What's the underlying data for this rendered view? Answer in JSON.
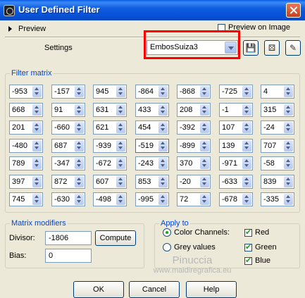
{
  "window": {
    "title": "User Defined Filter"
  },
  "preview": {
    "label": "Preview",
    "preview_on_image": "Preview on Image"
  },
  "settings": {
    "label": "Settings",
    "preset_value": "EmbosSuiza3",
    "icons": [
      "save-icon",
      "dice-icon",
      "delete-preset-icon"
    ]
  },
  "filter_matrix": {
    "legend": "Filter matrix",
    "rows": [
      [
        "-953",
        "-157",
        "945",
        "-864",
        "-868",
        "-725",
        "4"
      ],
      [
        "668",
        "91",
        "631",
        "433",
        "208",
        "-1",
        "315"
      ],
      [
        "201",
        "-660",
        "621",
        "454",
        "-392",
        "107",
        "-24"
      ],
      [
        "-480",
        "687",
        "-939",
        "-519",
        "-899",
        "139",
        "707"
      ],
      [
        "789",
        "-347",
        "-672",
        "-243",
        "370",
        "-971",
        "-58"
      ],
      [
        "397",
        "872",
        "607",
        "853",
        "-20",
        "-633",
        "839"
      ],
      [
        "745",
        "-630",
        "-498",
        "-995",
        "72",
        "-678",
        "-335"
      ]
    ]
  },
  "matrix_modifiers": {
    "legend": "Matrix modifiers",
    "divisor_label": "Divisor:",
    "divisor_value": "-1806",
    "compute_label": "Compute",
    "bias_label": "Bias:",
    "bias_value": "0"
  },
  "apply_to": {
    "legend": "Apply to",
    "color_channels": "Color Channels:",
    "grey_values": "Grey values",
    "red": "Red",
    "green": "Green",
    "blue": "Blue"
  },
  "watermark": {
    "line1": "Pinuccia",
    "line2": "www.maidiregrafica.eu"
  },
  "buttons": {
    "ok": "OK",
    "cancel": "Cancel",
    "help": "Help"
  }
}
